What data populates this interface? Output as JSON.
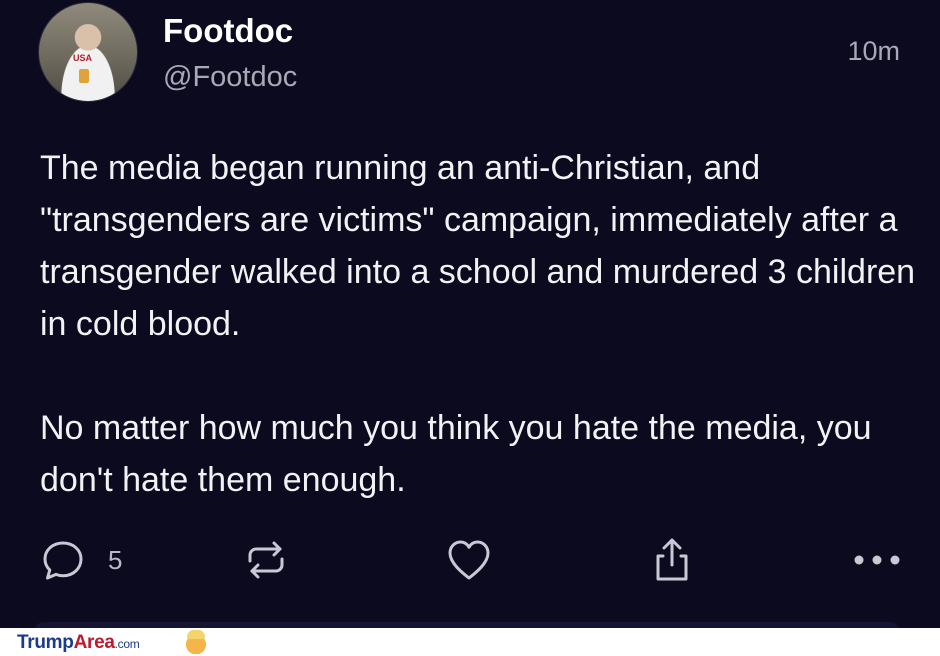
{
  "post": {
    "display_name": "Footdoc",
    "handle": "@Footdoc",
    "timestamp": "10m",
    "paragraphs": [
      "The media began running an anti-Christian, and \"transgenders are victims\" campaign, immediately after a transgender walked into a school and murdered 3 children in cold blood.",
      "No matter how much you think you hate the media, you don't hate them enough."
    ],
    "avatar_shirt_text": "USA"
  },
  "actions": {
    "reply_count": "5",
    "icons": [
      "reply-icon",
      "repost-icon",
      "like-icon",
      "share-icon",
      "more-icon"
    ]
  },
  "watermark": {
    "brand_part1": "Trump",
    "brand_part2": "Area",
    "brand_suffix": ".com"
  },
  "colors": {
    "background": "#0b0a1f",
    "text": "#f2f2f5",
    "secondary_text": "#a8a8b6",
    "brand_blue": "#1b3a8c",
    "brand_red": "#c0192f"
  }
}
